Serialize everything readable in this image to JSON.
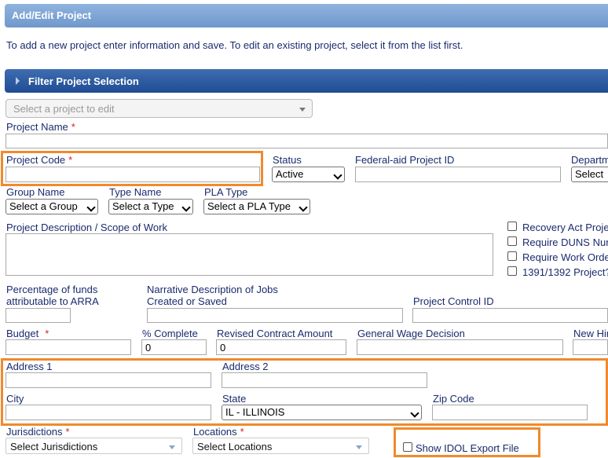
{
  "header": {
    "title": "Add/Edit Project"
  },
  "intro": "To add a new project enter information and save. To edit an existing project, select it from the list first.",
  "filter": {
    "title": "Filter Project Selection",
    "project_select_placeholder": "Select a project to edit"
  },
  "fields": {
    "project_name": "Project Name",
    "project_code": "Project Code",
    "status": "Status",
    "status_value": "Active",
    "federal_aid": "Federal-aid Project ID",
    "department": "Departm",
    "department_value": "Select",
    "group_name": "Group Name",
    "group_value": "Select a Group",
    "type_name": "Type Name",
    "type_value": "Select a Type",
    "pla_type": "PLA Type",
    "pla_value": "Select a PLA Type",
    "description": "Project Description / Scope of Work",
    "pct_funds": "Percentage of funds attributable to ARRA",
    "pct_funds_l1": "Percentage of funds",
    "pct_funds_l2": "attributable to ARRA",
    "narrative_l1": "Narrative Description of Jobs",
    "narrative_l2": "Created or Saved",
    "control_id": "Project Control ID",
    "budget": "Budget",
    "pct_complete": "% Complete",
    "pct_complete_value": "0",
    "revised_amount": "Revised Contract Amount",
    "revised_amount_value": "0",
    "wage_decision": "General Wage Decision",
    "new_hire": "New Hir",
    "address1": "Address 1",
    "address2": "Address 2",
    "city": "City",
    "state": "State",
    "state_value": "IL - ILLINOIS",
    "zip": "Zip Code",
    "jurisdictions": "Jurisdictions",
    "jurisdictions_value": "Select Jurisdictions",
    "locations": "Locations",
    "locations_value": "Select Locations"
  },
  "required_mark": "*",
  "checkboxes": {
    "recovery_act": "Recovery Act Proje",
    "duns": "Require DUNS Nur",
    "work_order": "Require Work Orde",
    "project_1391": "1391/1392 Project?",
    "idol_export": "Show IDOL Export File"
  },
  "colors": {
    "highlight": "#f08a2c",
    "label": "#1a2b6d",
    "required": "#d42020",
    "header": "#7aa2d4",
    "filter_bar": "#2d5ba2"
  }
}
